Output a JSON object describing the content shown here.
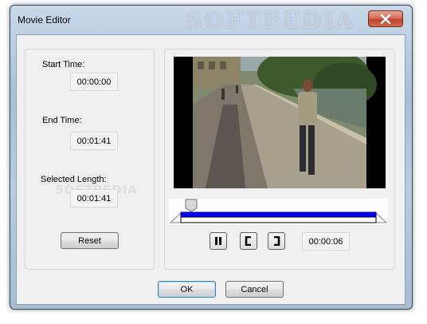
{
  "window": {
    "title": "Movie Editor",
    "watermark": "SOFTPEDIA"
  },
  "left": {
    "start_label": "Start Time:",
    "start_value": "00:00:00",
    "end_label": "End Time:",
    "end_value": "00:01:41",
    "length_label": "Selected Length:",
    "length_value": "00:01:41",
    "reset_label": "Reset",
    "watermark": "SOFTPEDIA"
  },
  "player": {
    "current_time": "00:00:06",
    "selection_color": "#0000ff"
  },
  "footer": {
    "ok_label": "OK",
    "cancel_label": "Cancel"
  },
  "icons": [
    "close-icon",
    "pause-icon",
    "mark-in-icon",
    "mark-out-icon",
    "slider-thumb-icon"
  ]
}
